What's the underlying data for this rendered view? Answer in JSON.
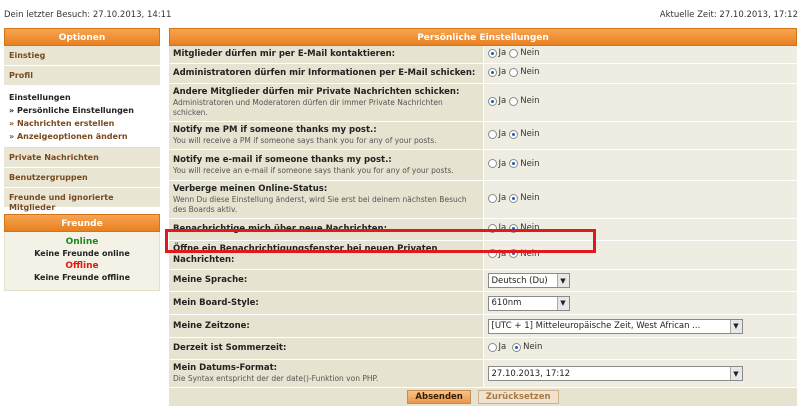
{
  "topbar": {
    "last_visit": "Dein letzter Besuch: 27.10.2013, 14:11",
    "current_time": "Aktuelle Zeit: 27.10.2013, 17:12"
  },
  "sidebar": {
    "title": "Optionen",
    "items": {
      "start": "Einstieg",
      "profile": "Profil",
      "settings": "Einstellungen",
      "settings_personal": "» Persönliche Einstellungen",
      "settings_messages": "» Nachrichten erstellen",
      "settings_display": "» Anzeigeoptionen ändern",
      "private_messages": "Private Nachrichten",
      "usergroups": "Benutzergruppen",
      "friends_foes": "Freunde und ignorierte Mitglieder"
    },
    "friends": {
      "title": "Freunde",
      "online": "Online",
      "online_none": "Keine Freunde online",
      "offline": "Offline",
      "offline_none": "Keine Freunde offline"
    }
  },
  "main": {
    "title": "Persönliche Einstellungen",
    "yes": "Ja",
    "no": "Nein",
    "rows": [
      {
        "label": "Mitglieder dürfen mir per E-Mail kontaktieren:",
        "desc": "",
        "value": "yes"
      },
      {
        "label": "Administratoren dürfen mir Informationen per E-Mail schicken:",
        "desc": "",
        "value": "yes"
      },
      {
        "label": "Andere Mitglieder dürfen mir Private Nachrichten schicken:",
        "desc": "Administratoren und Moderatoren dürfen dir immer Private Nachrichten schicken.",
        "value": "yes"
      },
      {
        "label": "Notify me PM if someone thanks my post.:",
        "desc": "You will receive a PM if someone says thank you for any of your posts.",
        "value": "no"
      },
      {
        "label": "Notify me e-mail if someone thanks my post.:",
        "desc": "You will receive an e-mail if someone says thank you for any of your posts.",
        "value": "no"
      },
      {
        "label": "Verberge meinen Online-Status:",
        "desc": "Wenn Du diese Einstellung änderst, wird Sie erst bei deinem nächsten Besuch des Boards aktiv.",
        "value": "no"
      },
      {
        "label": "Benachrichtige mich über neue Nachrichten:",
        "desc": "",
        "value": "no"
      },
      {
        "label": "Öffne ein Benachrichtigungsfenster bei neuen Privaten Nachrichten:",
        "desc": "",
        "value": "no"
      }
    ],
    "language": {
      "label": "Meine Sprache:",
      "value": "Deutsch (Du)"
    },
    "style": {
      "label": "Mein Board-Style:",
      "value": "610nm"
    },
    "timezone": {
      "label": "Meine Zeitzone:",
      "value": "[UTC + 1] Mitteleuropäische Zeit, West African ..."
    },
    "dst": {
      "label": "Derzeit ist Sommerzeit:",
      "value": "no"
    },
    "dateformat": {
      "label": "Mein Datums-Format:",
      "desc": "Die Syntax entspricht der der date()-Funktion von PHP.",
      "value": "27.10.2013, 17:12"
    },
    "submit": "Absenden",
    "reset": "Zurücksetzen"
  },
  "colors": {
    "accent": "#e8801f",
    "highlight": "#e0191f",
    "online": "#1c8a1c",
    "offline": "#e01a0b"
  }
}
